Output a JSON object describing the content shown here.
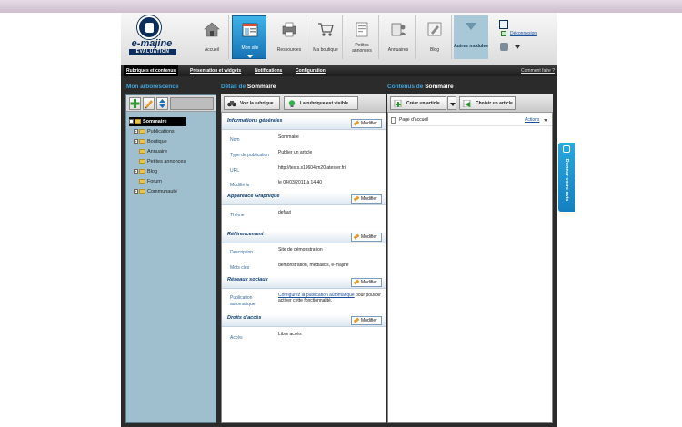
{
  "logo": {
    "brand": "e-majine",
    "edition": "EVALUATION"
  },
  "nav": {
    "tabs": [
      {
        "label": "Accueil",
        "icon": "house-icon"
      },
      {
        "label": "Mon site",
        "icon": "site-icon"
      },
      {
        "label": "Ressources",
        "icon": "printer-icon"
      },
      {
        "label": "Ma boutique",
        "icon": "cart-icon"
      },
      {
        "label": "Petites annonces",
        "icon": "ads-icon"
      },
      {
        "label": "Annuaires",
        "icon": "directory-icon"
      },
      {
        "label": "Blog",
        "icon": "blog-icon"
      },
      {
        "label": "Autres modules",
        "icon": "chevron-down-icon"
      }
    ],
    "active": "Mon site"
  },
  "user": {
    "logout_label": "Déconnexion"
  },
  "subnav": {
    "tabs": [
      "Rubriques et contenus",
      "Présentation et widgets",
      "Notifications",
      "Configuration"
    ],
    "help": "Comment faire ?"
  },
  "left": {
    "title": "Mon arborescence",
    "tree": [
      {
        "label": "Sommaire",
        "selected": true
      },
      {
        "label": "Publications"
      },
      {
        "label": "Boutique"
      },
      {
        "label": "Annuaire"
      },
      {
        "label": "Petites annonces"
      },
      {
        "label": "Blog"
      },
      {
        "label": "Forum"
      },
      {
        "label": "Communauté"
      }
    ]
  },
  "center": {
    "title_prefix": "Détail de",
    "title_name": "Sommaire",
    "btn_view": "Voir la rubrique",
    "btn_visible": "La rubrique est visible",
    "modify_label": "Modifier",
    "sections": {
      "general": {
        "title": "Informations générales",
        "fields": [
          {
            "label": "Nom",
            "value": "Sommaire"
          },
          {
            "label": "Type de publication",
            "value": "Publier un article"
          },
          {
            "label": "URL",
            "value": "http://tests.s19604.m20.atester.fr/"
          },
          {
            "label": "Modifié le",
            "value": "le 04/03/2011 à 14:40"
          }
        ]
      },
      "appearance": {
        "title": "Apparence Graphique",
        "label": "Thème",
        "value": "defaut"
      },
      "seo": {
        "title": "Référencement",
        "fields": [
          {
            "label": "Description",
            "value": "Site de démonstration"
          },
          {
            "label": "Mots clés",
            "value": "demonstration, medialibs, e-majine"
          }
        ]
      },
      "social": {
        "title": "Réseaux sociaux",
        "label": "Publication automatique",
        "link": "Configurez la publication automatique",
        "text": " pour pouvoir activer cette fonctionnalité."
      },
      "rights": {
        "title": "Droits d'accès",
        "label": "Accès",
        "value": "Libre accès"
      }
    }
  },
  "right": {
    "title_prefix": "Contenus de",
    "title_name": "Sommaire",
    "btn_create": "Créer un article",
    "btn_choose": "Choisir un article",
    "item": "Page d'accueil",
    "actions": "Actions"
  },
  "feedback": {
    "label": "Donner votre avis"
  }
}
